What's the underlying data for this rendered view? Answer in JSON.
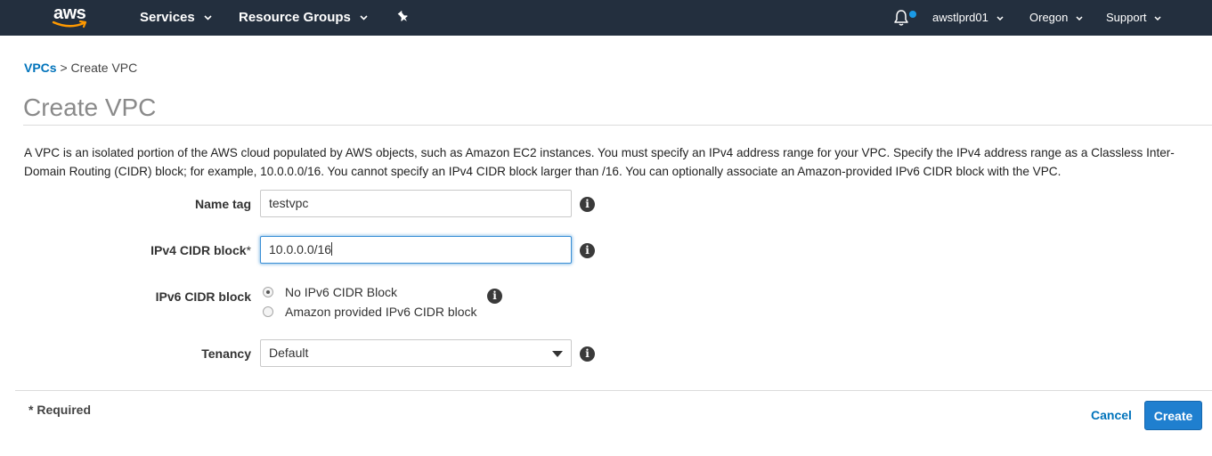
{
  "nav": {
    "logo_text": "aws",
    "services": "Services",
    "resource_groups": "Resource Groups",
    "account": "awstlprd01",
    "region": "Oregon",
    "support": "Support",
    "icons": [
      "pin-icon",
      "bell-icon",
      "chevron-down-icon"
    ],
    "notification_dot_color": "#1a9ae6"
  },
  "breadcrumb": {
    "link": "VPCs",
    "separator": ">",
    "current": "Create VPC"
  },
  "page": {
    "title": "Create VPC",
    "description": "A VPC is an isolated portion of the AWS cloud populated by AWS objects, such as Amazon EC2 instances. You must specify an IPv4 address range for your VPC. Specify the IPv4 address range as a Classless Inter-Domain Routing (CIDR) block; for example, 10.0.0.0/16. You cannot specify an IPv4 CIDR block larger than /16. You can optionally associate an Amazon-provided IPv6 CIDR block with the VPC."
  },
  "form": {
    "name_tag": {
      "label": "Name tag",
      "value": "testvpc"
    },
    "ipv4": {
      "label": "IPv4 CIDR block",
      "required_mark": "*",
      "value": "10.0.0.0/16"
    },
    "ipv6": {
      "label": "IPv6 CIDR block",
      "options": [
        "No IPv6 CIDR Block",
        "Amazon provided IPv6 CIDR block"
      ],
      "selected": "No IPv6 CIDR Block"
    },
    "tenancy": {
      "label": "Tenancy",
      "value": "Default"
    },
    "info_glyph": "i"
  },
  "footer": {
    "required_note": "* Required",
    "cancel": "Cancel",
    "create": "Create"
  },
  "colors": {
    "nav_bg": "#232f3e",
    "link": "#0073bb",
    "primary_button": "#1f7fcf"
  }
}
